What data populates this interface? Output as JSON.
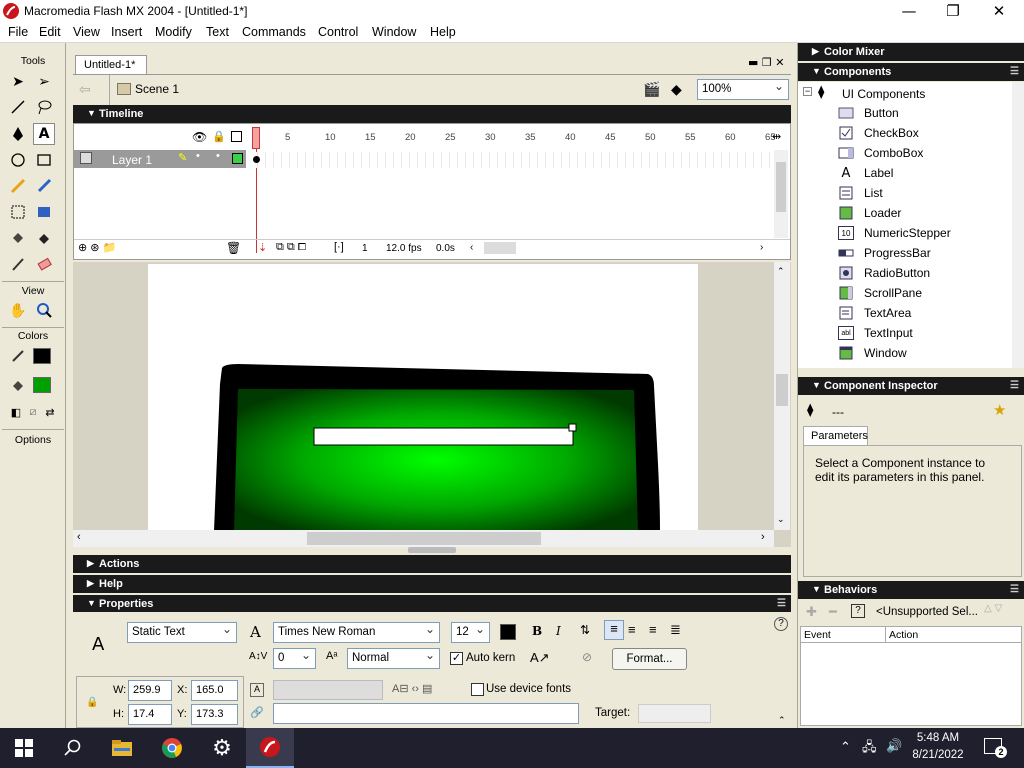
{
  "window": {
    "title": "Macromedia Flash MX 2004 - [Untitled-1*]",
    "controls": {
      "minimize": "—",
      "restore": "❐",
      "close": "✕"
    }
  },
  "menu": [
    "File",
    "Edit",
    "View",
    "Insert",
    "Modify",
    "Text",
    "Commands",
    "Control",
    "Window",
    "Help"
  ],
  "tools": {
    "header": "Tools",
    "view_header": "View",
    "colors_header": "Colors",
    "options_header": "Options",
    "items": [
      "arrow-icon",
      "subselect-icon",
      "line-icon",
      "lasso-icon",
      "pen-icon",
      "text-icon",
      "oval-icon",
      "rectangle-icon",
      "pencil-icon",
      "brush-icon",
      "free-transform-icon",
      "fill-transform-icon",
      "ink-bottle-icon",
      "paint-bucket-icon",
      "eyedropper-icon",
      "eraser-icon",
      "hand-icon",
      "zoom-icon"
    ],
    "stroke_color": "#000000",
    "fill_color": "#00a000"
  },
  "document": {
    "tab": "Untitled-1*",
    "scene": "Scene 1",
    "zoom": "100%"
  },
  "timeline": {
    "title": "Timeline",
    "layer": "Layer 1",
    "frame_numbers": [
      "1",
      "5",
      "10",
      "15",
      "20",
      "25",
      "30",
      "35",
      "40",
      "45",
      "50",
      "55",
      "60",
      "65"
    ],
    "current_frame": "1",
    "fps": "12.0 fps",
    "elapsed": "0.0s"
  },
  "panels": {
    "actions": "Actions",
    "help": "Help",
    "properties": "Properties",
    "color_mixer": "Color Mixer",
    "components": "Components",
    "component_inspector": "Component Inspector",
    "behaviors": "Behaviors"
  },
  "components": {
    "group": "UI Components",
    "items": [
      "Button",
      "CheckBox",
      "ComboBox",
      "Label",
      "List",
      "Loader",
      "NumericStepper",
      "ProgressBar",
      "RadioButton",
      "ScrollPane",
      "TextArea",
      "TextInput",
      "Window"
    ]
  },
  "inspector": {
    "none_label": "---",
    "tab": "Parameters",
    "message": "Select a Component instance to edit its parameters in this panel."
  },
  "behaviors": {
    "selector": "<Unsupported Sel...",
    "col_event": "Event",
    "col_action": "Action"
  },
  "properties": {
    "text_type": "Static Text",
    "font": "Times New Roman",
    "size": "12",
    "bold": "B",
    "italic": "I",
    "tracking": "0",
    "baseline": "Normal",
    "auto_kern_label": "Auto kern",
    "auto_kern": true,
    "format_button": "Format...",
    "w_label": "W:",
    "w": "259.9",
    "h_label": "H:",
    "h": "17.4",
    "x_label": "X:",
    "x": "165.0",
    "y_label": "Y:",
    "y": "173.3",
    "device_fonts_label": "Use device fonts",
    "target_label": "Target:",
    "help": "?"
  },
  "taskbar": {
    "time": "5:48 AM",
    "date": "8/21/2022",
    "notifications": "2"
  }
}
